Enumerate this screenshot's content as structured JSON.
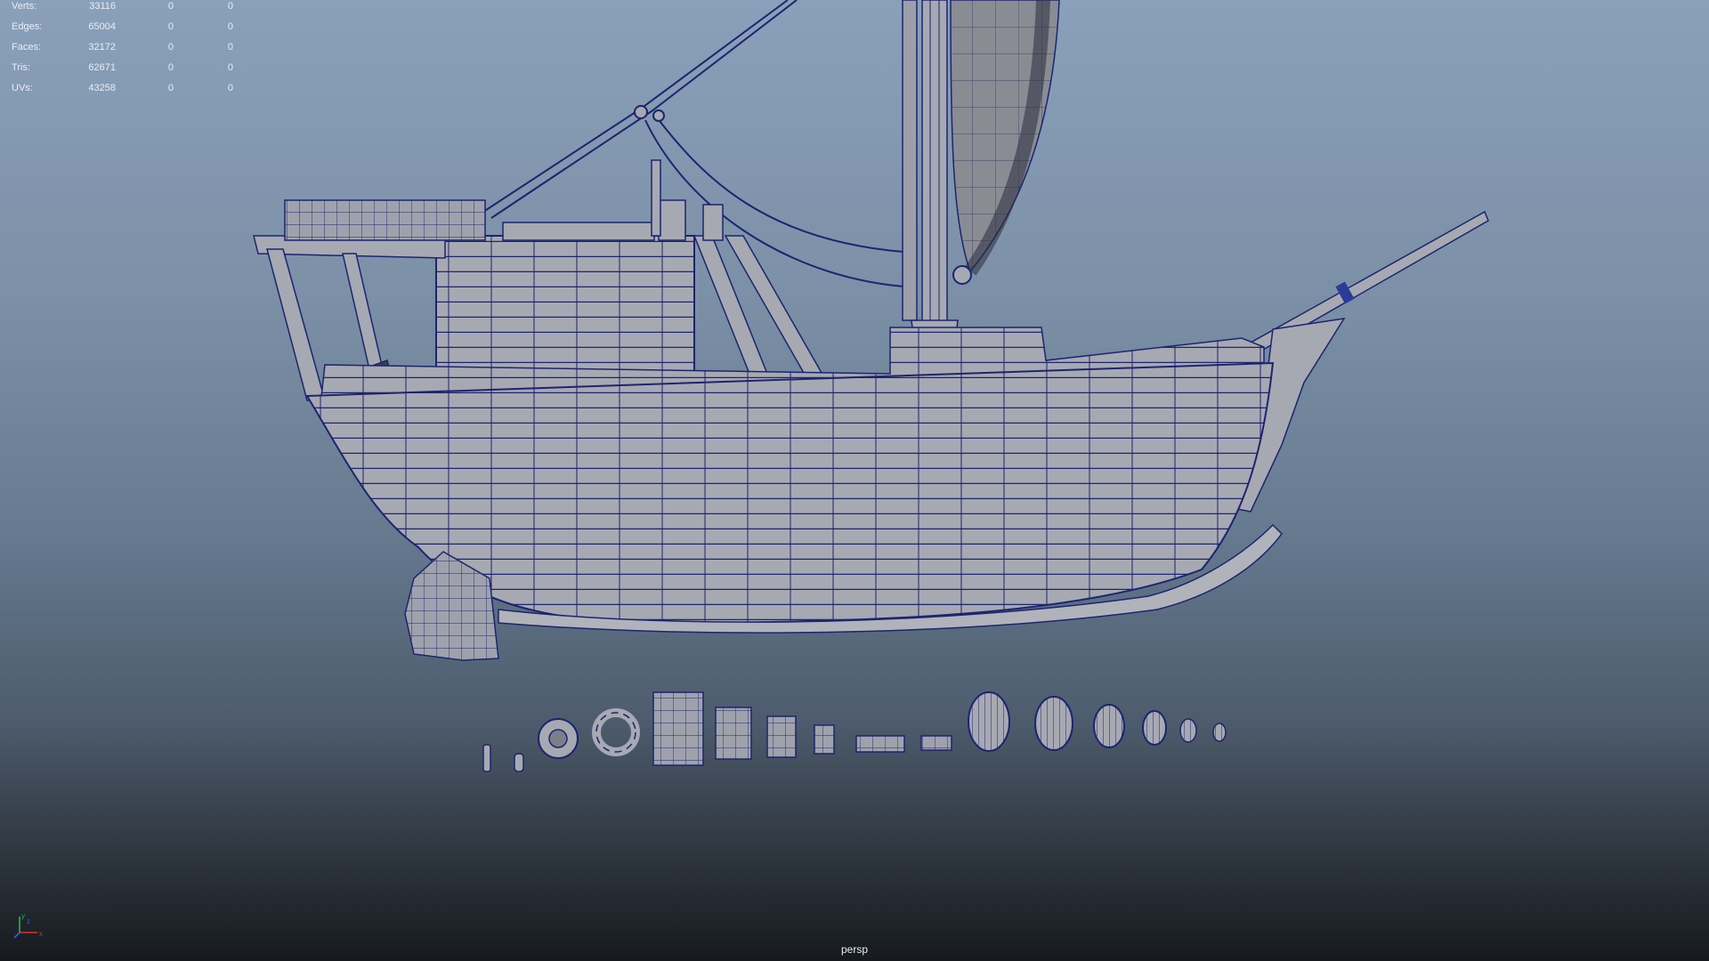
{
  "viewport": {
    "camera": "persp",
    "background_top": "#8aa0ba",
    "background_bottom": "#161a1f",
    "wire_color": "#1c2470",
    "mesh_color": "#a7a9b2"
  },
  "hud": {
    "rows": [
      {
        "label": "Verts:",
        "v1": "33116",
        "v2": "0",
        "v3": "0"
      },
      {
        "label": "Edges:",
        "v1": "65004",
        "v2": "0",
        "v3": "0"
      },
      {
        "label": "Faces:",
        "v1": "32172",
        "v2": "0",
        "v3": "0"
      },
      {
        "label": "Tris:",
        "v1": "62671",
        "v2": "0",
        "v3": "0"
      },
      {
        "label": "UVs:",
        "v1": "43258",
        "v2": "0",
        "v3": "0"
      }
    ]
  },
  "scene": {
    "main_model": "sailing-boat",
    "props": [
      "bottle",
      "bottle",
      "porthole",
      "life-ring",
      "crate",
      "crate",
      "crate",
      "crate",
      "plank",
      "plank",
      "barrel",
      "barrel",
      "barrel",
      "barrel",
      "barrel",
      "barrel"
    ]
  },
  "axis_gizmo": {
    "x": "x",
    "y": "y",
    "z": "z",
    "x_color": "#d2342c",
    "y_color": "#2fb34a",
    "z_color": "#3b5bd8"
  }
}
